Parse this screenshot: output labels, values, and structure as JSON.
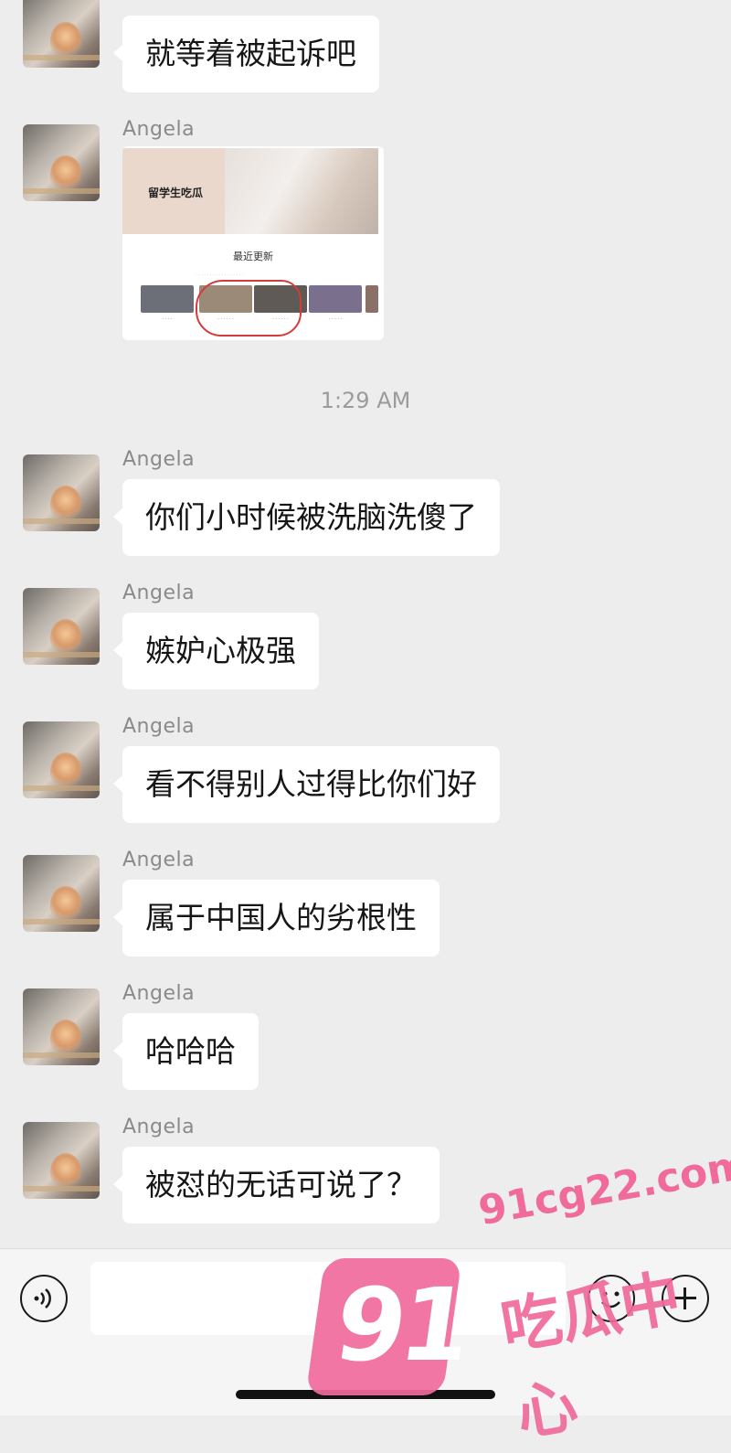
{
  "chat": {
    "contact_name": "Angela",
    "timestamp": "1:29 AM",
    "messages_top": [
      {
        "text": "就等着被起诉吧"
      }
    ],
    "image_card": {
      "hero_title": "留学生吃瓜",
      "section_title": "最近更新"
    },
    "messages_after_time": [
      {
        "sender": "Angela",
        "text": "你们小时候被洗脑洗傻了"
      },
      {
        "sender": "Angela",
        "text": "嫉妒心极强"
      },
      {
        "sender": "Angela",
        "text": "看不得别人过得比你们好"
      },
      {
        "sender": "Angela",
        "text": "属于中国人的劣根性"
      },
      {
        "sender": "Angela",
        "text": "哈哈哈"
      },
      {
        "sender": "Angela",
        "text": "被怼的无话可说了？"
      }
    ]
  },
  "input_bar": {
    "voice_icon": "voice-icon",
    "emoji_icon": "emoji-icon",
    "plus_icon": "plus-icon"
  },
  "watermark": {
    "number": "91",
    "url": "91cg22.com",
    "name": "吃瓜中心",
    "color": "#f06a9c"
  }
}
